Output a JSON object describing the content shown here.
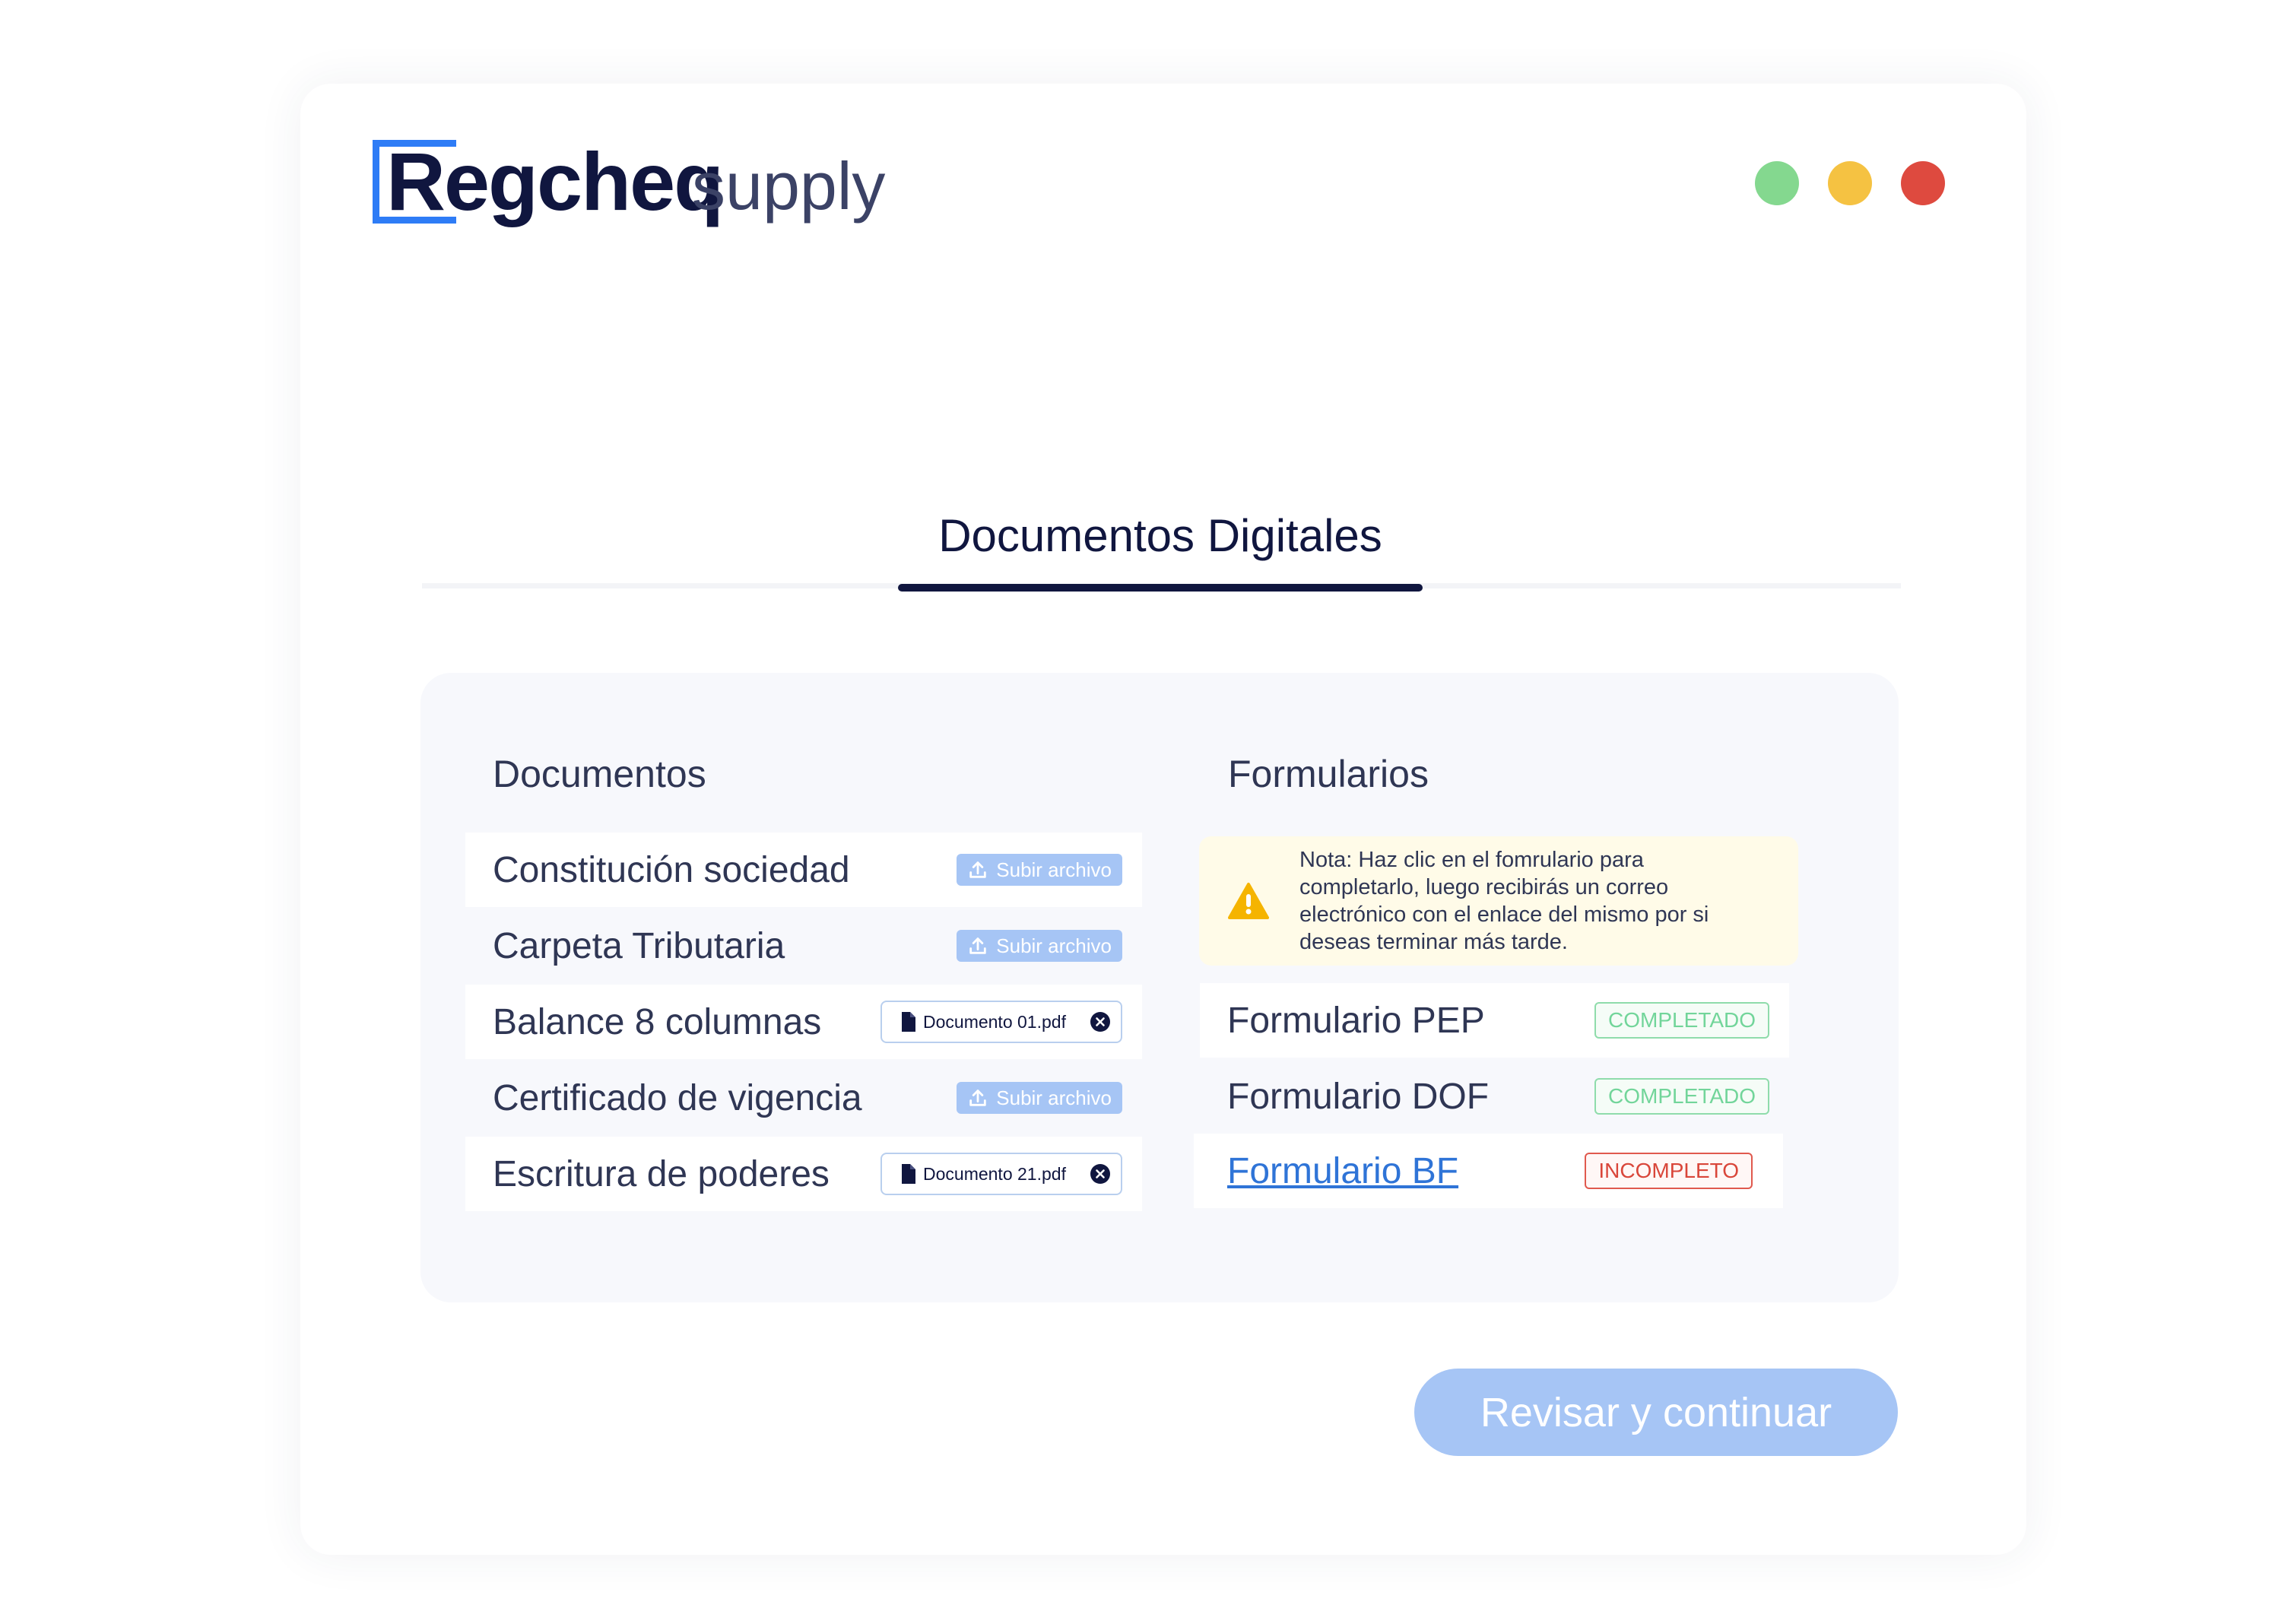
{
  "brand": {
    "name": "Regcheq",
    "product": "supply",
    "accent_color": "#2e7cf6"
  },
  "window_controls": [
    "green-dot",
    "yellow-dot",
    "red-dot"
  ],
  "tab": {
    "label": "Documentos Digitales"
  },
  "documents": {
    "title": "Documentos",
    "items": [
      {
        "label": "Constitución sociedad",
        "action": "Subir archivo",
        "icon": "upload-icon"
      },
      {
        "label": "Carpeta Tributaria",
        "action": "Subir archivo",
        "icon": "upload-icon"
      },
      {
        "label": "Balance 8 columnas",
        "file": "Documento 01.pdf",
        "icon": "file-icon"
      },
      {
        "label": "Certificado de vigencia",
        "action": "Subir archivo",
        "icon": "upload-icon"
      },
      {
        "label": "Escritura de poderes",
        "file": "Documento 21.pdf",
        "icon": "file-icon"
      }
    ]
  },
  "forms": {
    "title": "Formularios",
    "note": "Nota: Haz clic en el fomrulario para completarlo, luego recibirás un correo electrónico con el enlace del mismo por si deseas terminar más tarde.",
    "items": [
      {
        "label": "Formulario PEP",
        "status": "COMPLETADO"
      },
      {
        "label": "Formulario DOF",
        "status": "COMPLETADO"
      },
      {
        "label": "Formulario BF",
        "status": "INCOMPLETO"
      }
    ]
  },
  "cta": {
    "label": "Revisar y continuar"
  },
  "colors": {
    "navy": "#10163f",
    "ok": "#72d59a",
    "error": "#d9463a",
    "button": "#a6c5f5"
  }
}
